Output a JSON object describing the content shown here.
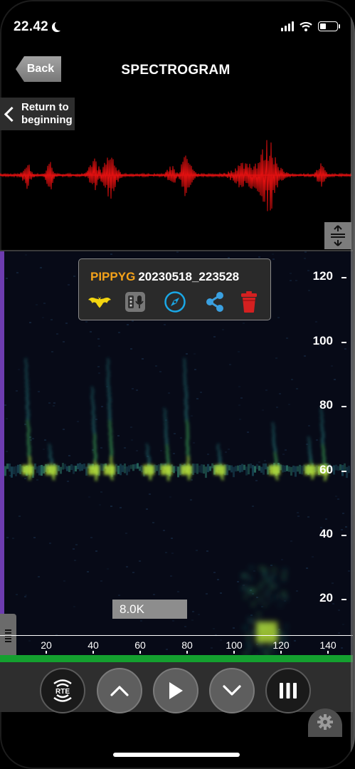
{
  "status_bar": {
    "time": "22.42"
  },
  "header": {
    "back_label": "Back",
    "title": "SPECTROGRAM"
  },
  "return_button": {
    "label_line1": "Return to",
    "label_line2": "beginning"
  },
  "info_popup": {
    "species_code": "PIPPYG",
    "file_id": "20230518_223528"
  },
  "spectrogram": {
    "y_axis_labels": [
      "120",
      "100",
      "80",
      "60",
      "40",
      "20"
    ],
    "x_axis_labels": [
      "20",
      "40",
      "60",
      "80",
      "100",
      "120",
      "140"
    ],
    "sample_rate_label": "8.0K"
  },
  "controls": {
    "rte_label": "RTE"
  },
  "colors": {
    "waveform": "#e01010",
    "species": "#f4a21a",
    "accent_purple": "#6d3cb0",
    "progress_green": "#14a02f",
    "compass_blue": "#1aa7e6",
    "share_blue": "#3aa0e0",
    "trash_red": "#d42020"
  },
  "icons": [
    "moon-icon",
    "signal-icon",
    "wifi-icon",
    "battery-icon",
    "bat-icon",
    "recorder-icon",
    "compass-icon",
    "share-icon",
    "trash-icon",
    "vertical-resize-icon",
    "drag-handle-icon",
    "up-chevron-icon",
    "play-icon",
    "down-chevron-icon",
    "pause-bars-icon",
    "gear-icon"
  ]
}
